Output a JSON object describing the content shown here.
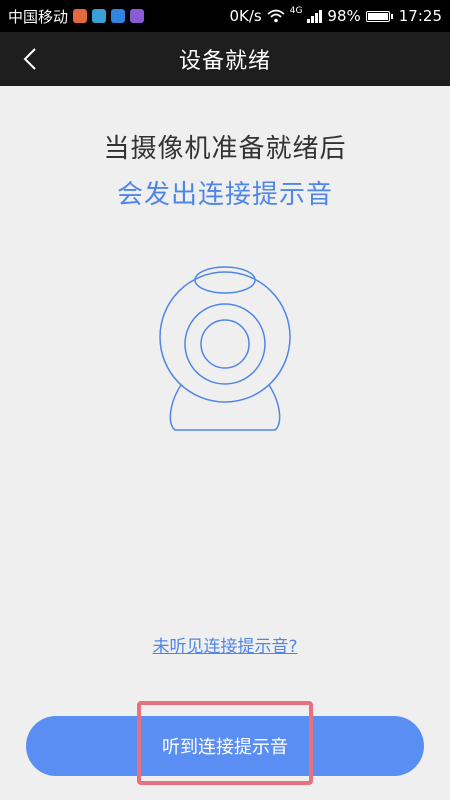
{
  "status_bar": {
    "carrier": "中国移动",
    "network_speed": "0K/s",
    "network_type": "4G",
    "battery_percent": "98%",
    "time": "17:25",
    "app_icons": [
      "app-notification-orange-icon",
      "app-notification-cyan-icon",
      "chat-bubble-icon",
      "app-notification-purple-icon"
    ],
    "app_icon_colors": [
      "#e2693c",
      "#3aa0d8",
      "#2f86e0",
      "#8b5bd6"
    ],
    "icons": [
      "wifi-icon",
      "signal-icon",
      "battery-icon"
    ]
  },
  "header": {
    "title": "设备就绪",
    "back_icon": "chevron-left-icon"
  },
  "main": {
    "headline": "当摄像机准备就绪后",
    "subheadline": "会发出连接提示音",
    "illustration_icon": "webcam-icon",
    "help_link": "未听见连接提示音?",
    "confirm_button": "听到连接提示音"
  },
  "colors": {
    "accent": "#4f86e8",
    "button": "#5a8ef2",
    "highlight": "#e8707f",
    "header_bg": "#1e1e1e",
    "page_bg": "#efefef"
  }
}
